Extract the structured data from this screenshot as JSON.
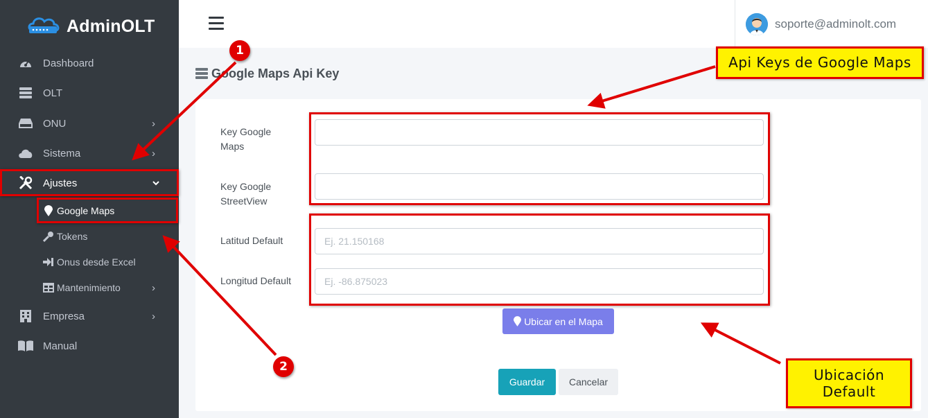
{
  "brand": {
    "name": "AdminOLT",
    "logo_icon": "router-cloud-icon"
  },
  "sidebar": {
    "items": [
      {
        "label": "Dashboard",
        "icon": "tachometer-icon"
      },
      {
        "label": "OLT",
        "icon": "server-icon"
      },
      {
        "label": "ONU",
        "icon": "hdd-icon",
        "chevron": "›"
      },
      {
        "label": "Sistema",
        "icon": "cloud-icon",
        "chevron": "›"
      },
      {
        "label": "Ajustes",
        "icon": "tools-icon",
        "chevron": "⌄"
      },
      {
        "label": "Empresa",
        "icon": "building-icon",
        "chevron": "›"
      },
      {
        "label": "Manual",
        "icon": "book-icon"
      }
    ],
    "subitems": [
      {
        "label": "Google Maps",
        "icon": "map-marker-icon"
      },
      {
        "label": "Tokens",
        "icon": "key-icon"
      },
      {
        "label": "Onus desde Excel",
        "icon": "sign-in-icon"
      },
      {
        "label": "Mantenimiento",
        "icon": "table-icon",
        "chevron": "›"
      }
    ]
  },
  "header": {
    "user_email": "soporte@adminolt.com",
    "menu_icon": "bars-icon"
  },
  "page": {
    "title": "Google Maps Api Key",
    "title_icon": "server-icon"
  },
  "form": {
    "key_maps_label": "Key Google Maps",
    "key_maps_value": "",
    "key_streetview_label": "Key Google StreetView",
    "key_streetview_value": "",
    "latitud_label": "Latitud Default",
    "latitud_placeholder": "Ej. 21.150168",
    "longitud_label": "Longitud Default",
    "longitud_placeholder": "Ej. -86.875023",
    "ubicar_label": "Ubicar en el Mapa",
    "guardar_label": "Guardar",
    "cancelar_label": "Cancelar"
  },
  "annotations": {
    "callout_api": "Api Keys de Google Maps",
    "callout_ubicacion_line1": "Ubicación",
    "callout_ubicacion_line2": "Default",
    "badge_1": "1",
    "badge_2": "2"
  },
  "colors": {
    "sidebar_bg": "#343a40",
    "annotation_red": "#e00000",
    "callout_yellow": "#fff200",
    "guardar": "#17a2b8",
    "ubicar": "#7a7eea"
  }
}
